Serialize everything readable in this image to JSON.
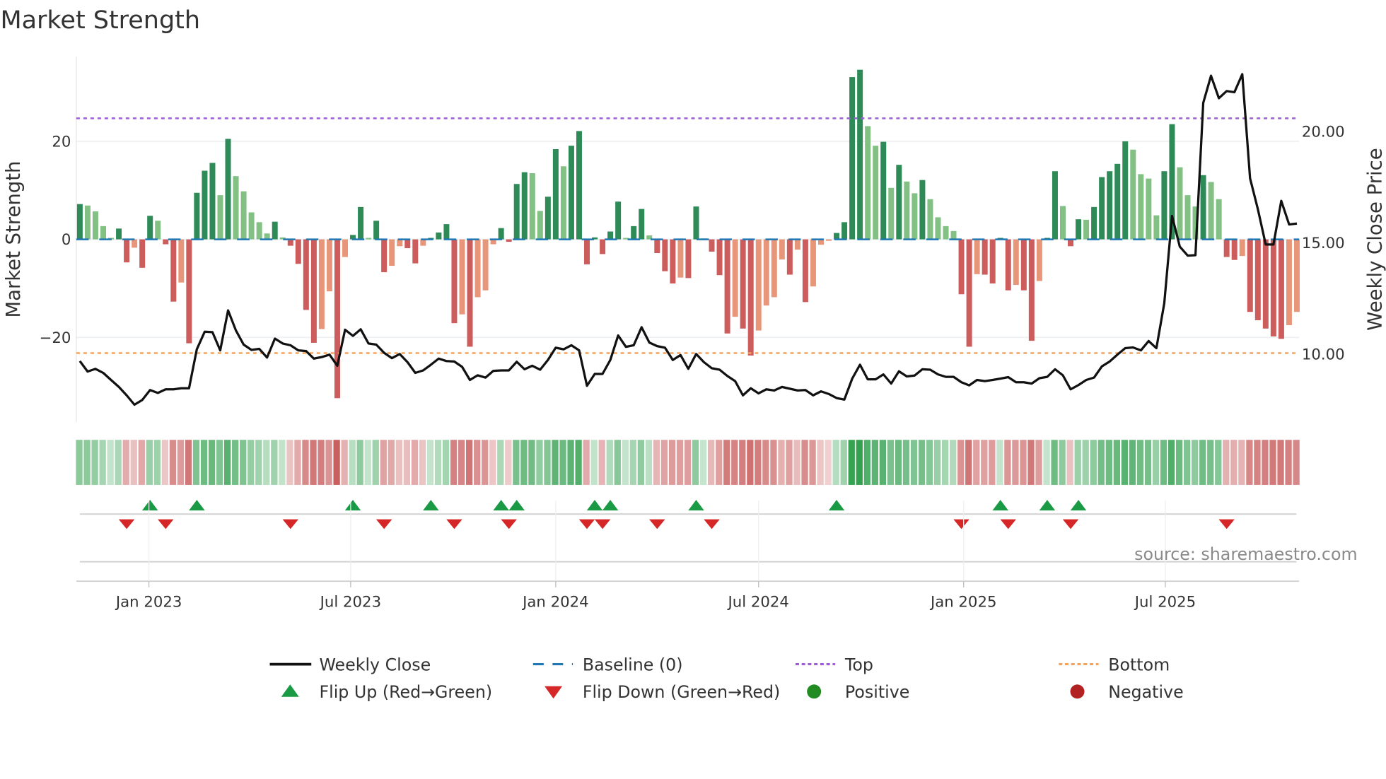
{
  "title": "Market Strength",
  "source": "source: sharemaestro.com",
  "colors": {
    "pos_strong": "#2e8b57",
    "pos_weak": "#82c084",
    "neg_strong": "#cd5c5c",
    "neg_weak": "#e8967a",
    "baseline": "#1f77b4",
    "top": "#9b5fd6",
    "bottom": "#f2a45f",
    "close": "#111111",
    "flip_up": "#1a9a44",
    "flip_down": "#d62728",
    "positive": "#228b22",
    "negative": "#b22222"
  },
  "legend": [
    {
      "key": "close",
      "label": "Weekly Close"
    },
    {
      "key": "baseline",
      "label": "Baseline (0)"
    },
    {
      "key": "top",
      "label": "Top"
    },
    {
      "key": "bottom",
      "label": "Bottom"
    },
    {
      "key": "flip_up",
      "label": "Flip Up (Red→Green)"
    },
    {
      "key": "flip_down",
      "label": "Flip Down (Green→Red)"
    },
    {
      "key": "positive",
      "label": "Positive"
    },
    {
      "key": "negative",
      "label": "Negative"
    }
  ],
  "chart_data": {
    "type": "bar",
    "title": "Market Strength",
    "ylabel": "Market Strength",
    "y2label": "Weekly Close Price",
    "first_week": "2022-10-31",
    "frequency": "weekly",
    "ylim": [
      -37,
      37
    ],
    "y2lim": [
      7,
      22.8
    ],
    "yticks": [
      {
        "value": 20,
        "label": "20"
      },
      {
        "value": 0,
        "label": "0"
      },
      {
        "value": -20,
        "label": "−20"
      }
    ],
    "y2ticks": [
      {
        "value": 20,
        "label": "20.00"
      },
      {
        "value": 15,
        "label": "15.00"
      },
      {
        "value": 10,
        "label": "10.00"
      }
    ],
    "xticks": [
      {
        "date": "2023-01-01",
        "label": "Jan 2023"
      },
      {
        "date": "2023-07-01",
        "label": "Jul 2023"
      },
      {
        "date": "2024-01-01",
        "label": "Jan 2024"
      },
      {
        "date": "2024-07-01",
        "label": "Jul 2024"
      },
      {
        "date": "2025-01-01",
        "label": "Jan 2025"
      },
      {
        "date": "2025-07-01",
        "label": "Jul 2025"
      }
    ],
    "top_threshold": 24.7,
    "bottom_threshold": -23.2,
    "baseline": 0,
    "strength": [
      7.2,
      6.9,
      5.7,
      2.7,
      0.3,
      2.2,
      -4.7,
      -1.7,
      -5.8,
      4.8,
      3.8,
      -1.0,
      -12.7,
      -8.8,
      -21.2,
      9.5,
      14.0,
      15.6,
      9.0,
      20.5,
      12.9,
      9.8,
      5.5,
      3.5,
      1.2,
      3.6,
      0.4,
      -1.3,
      -5.0,
      -14.4,
      -21.1,
      -18.3,
      -10.6,
      -32.4,
      -3.6,
      0.9,
      6.6,
      0.3,
      3.8,
      -6.7,
      -5.4,
      -1.4,
      -1.8,
      -4.9,
      -1.3,
      0.3,
      1.4,
      3.1,
      -17.1,
      -15.3,
      -21.9,
      -11.8,
      -10.4,
      -1.0,
      2.3,
      -0.5,
      11.3,
      13.7,
      13.5,
      5.8,
      8.7,
      18.4,
      14.9,
      19.1,
      22.1,
      -5.1,
      0.4,
      -3.0,
      1.6,
      7.7,
      0.3,
      2.7,
      6.2,
      0.8,
      -2.8,
      -6.5,
      -9.0,
      -7.8,
      -7.9,
      6.7,
      0.2,
      -2.5,
      -7.3,
      -19.2,
      -15.8,
      -18.2,
      -23.7,
      -18.6,
      -13.5,
      -11.8,
      -4.1,
      -7.2,
      -2.1,
      -12.8,
      -9.6,
      -1.1,
      -0.3,
      1.3,
      3.5,
      33.1,
      34.6,
      23.1,
      19.1,
      19.9,
      10.5,
      15.2,
      11.8,
      9.4,
      12.1,
      8.2,
      4.5,
      2.7,
      1.7,
      -11.2,
      -21.9,
      -7.1,
      -7.2,
      -9.0,
      0.3,
      -10.4,
      -9.3,
      -10.4,
      -20.7,
      -8.5,
      0.3,
      13.9,
      6.8,
      -1.4,
      4.1,
      4.0,
      6.6,
      12.7,
      13.9,
      15.4,
      20.0,
      18.3,
      13.3,
      12.4,
      4.9,
      13.9,
      23.5,
      14.7,
      9.0,
      6.7,
      13.1,
      11.7,
      8.2,
      -3.6,
      -4.2,
      -3.4,
      -14.8,
      -16.5,
      -18.2,
      -19.8,
      -20.3,
      -17.5,
      -14.8
    ],
    "weekly_close": [
      9.65,
      9.18,
      9.3,
      9.12,
      8.8,
      8.49,
      8.11,
      7.69,
      7.9,
      8.35,
      8.22,
      8.38,
      8.38,
      8.43,
      8.43,
      10.18,
      10.97,
      10.95,
      10.13,
      11.93,
      11.03,
      10.39,
      10.15,
      10.2,
      9.81,
      10.66,
      10.44,
      10.36,
      10.13,
      10.1,
      9.76,
      9.83,
      9.94,
      9.44,
      11.06,
      10.78,
      11.08,
      10.44,
      10.39,
      10.02,
      9.78,
      9.97,
      9.6,
      9.12,
      9.23,
      9.49,
      9.76,
      9.65,
      9.63,
      9.39,
      8.8,
      9.01,
      8.91,
      9.21,
      9.23,
      9.23,
      9.62,
      9.28,
      9.44,
      9.26,
      9.7,
      10.25,
      10.18,
      10.36,
      10.13,
      8.54,
      9.07,
      9.07,
      9.7,
      10.8,
      10.29,
      10.36,
      11.17,
      10.48,
      10.32,
      10.25,
      9.7,
      9.92,
      9.3,
      9.97,
      9.6,
      9.33,
      9.26,
      8.98,
      8.75,
      8.11,
      8.43,
      8.2,
      8.38,
      8.33,
      8.49,
      8.41,
      8.33,
      8.35,
      8.11,
      8.29,
      8.17,
      7.99,
      7.92,
      8.86,
      9.49,
      8.83,
      8.83,
      9.05,
      8.64,
      9.19,
      8.96,
      9.0,
      9.28,
      9.26,
      9.05,
      8.94,
      8.94,
      8.7,
      8.56,
      8.8,
      8.75,
      8.8,
      8.86,
      8.93,
      8.7,
      8.7,
      8.64,
      8.88,
      8.94,
      9.28,
      9.01,
      8.38,
      8.57,
      8.8,
      8.91,
      9.41,
      9.63,
      9.94,
      10.23,
      10.26,
      10.13,
      10.55,
      10.23,
      12.25,
      16.17,
      14.79,
      14.39,
      14.41,
      21.25,
      22.47,
      21.46,
      21.78,
      21.73,
      22.54,
      17.86,
      16.48,
      14.89,
      14.89,
      16.85,
      15.79,
      15.83
    ]
  }
}
